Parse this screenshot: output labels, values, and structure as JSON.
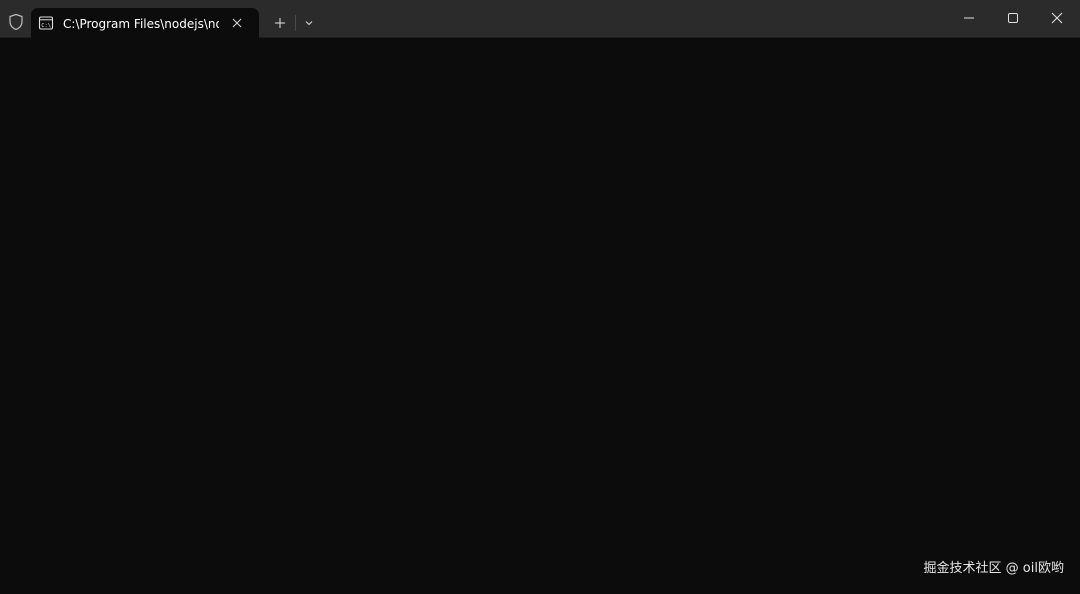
{
  "window": {
    "background_color": "#0c0c0c",
    "titlebar_color": "#2b2b2b"
  },
  "titlebar": {
    "shield_icon": "shield-icon",
    "tab": {
      "title": "C:\\Program Files\\nodejs\\node.exe",
      "icon": "terminal-cmd-icon",
      "close_icon": "close-icon"
    },
    "new_tab_icon": "plus-icon",
    "dropdown_icon": "chevron-down-icon"
  },
  "window_controls": {
    "minimize_icon": "minimize-icon",
    "maximize_icon": "maximize-icon",
    "close_icon": "close-icon"
  },
  "watermark": {
    "text": "掘金技术社区 @ oil欧哟"
  }
}
